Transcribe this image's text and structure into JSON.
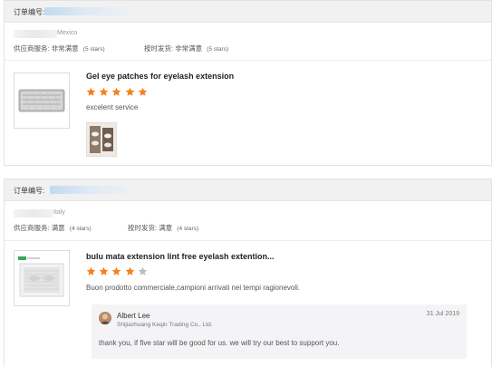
{
  "orders": [
    {
      "order_label": "订单编号:",
      "buyer_country": "Mexico",
      "supplier_service_label": "供应商服务:",
      "supplier_service_value": "非常满意",
      "supplier_service_stars": "(5 stars)",
      "shipping_label": "按时发货:",
      "shipping_value": "非常满意",
      "shipping_stars": "(5 stars)",
      "product_title": "Gel eye patches for eyelash extension",
      "rating": 5,
      "review_text": "excelent service",
      "has_photo": true
    },
    {
      "order_label": "订单编号:",
      "buyer_country": "Italy",
      "supplier_service_label": "供应商服务:",
      "supplier_service_value": "满意",
      "supplier_service_stars": "(4 stars)",
      "shipping_label": "按时发货:",
      "shipping_value": "满意",
      "shipping_stars": "(4 stars)",
      "product_title": "bulu mata extension lint free eyelash extention...",
      "rating": 4,
      "review_text": "Buon prodotto commerciale,campioni arrivati nei tempi ragionevoli.",
      "reply": {
        "name": "Albert Lee",
        "company": "Shijiazhuang Keqin Trading Co., Ltd.",
        "date": "31 Jul 2019",
        "text": "thank you, if five star will be good for us. we will try our best to support you."
      }
    }
  ],
  "colors": {
    "star_filled": "#f5811f",
    "star_empty": "#bdbdbd"
  }
}
